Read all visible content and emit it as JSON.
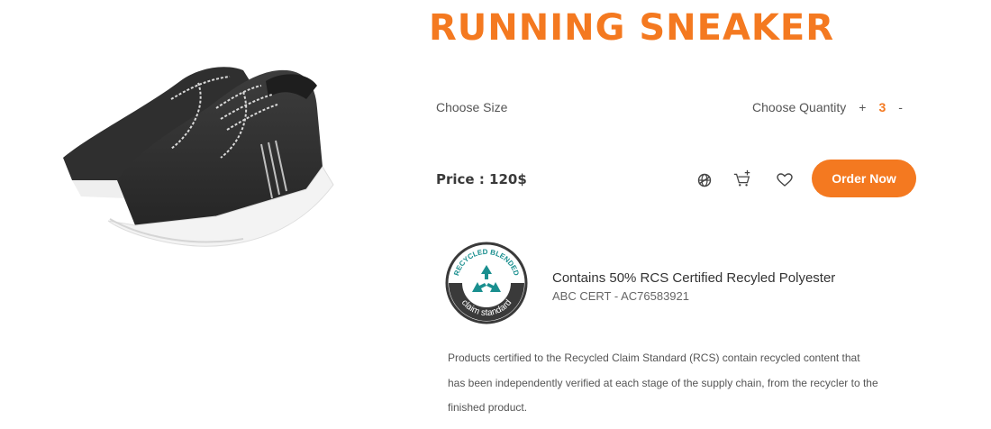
{
  "product": {
    "title": "RUNNING SNEAKER",
    "image_alt_icon": "sneaker-photo"
  },
  "options": {
    "size_label": "Choose Size",
    "quantity_label": "Choose Quantity",
    "increment_label": "+",
    "decrement_label": "-",
    "quantity_value": "3"
  },
  "pricing": {
    "price_text": "Price : 120$"
  },
  "actions": {
    "compare_icon": "compare-globe-icon",
    "cart_icon": "add-to-cart-icon",
    "wishlist_icon": "heart-icon",
    "order_label": "Order Now"
  },
  "certification": {
    "badge_top_text": "RECYCLED BLENDED",
    "badge_bottom_text": "claim standard",
    "title": "Contains 50% RCS Certified Recyled Polyester",
    "code": "ABC CERT - AC76583921",
    "description": "Products certified to the Recycled Claim Standard (RCS) contain recycled content that has been independently verified at each stage of the supply chain, from the recycler to the finished product."
  },
  "colors": {
    "accent": "#f47920",
    "badge_teal": "#1a8f8f",
    "text": "#3a3a3a"
  }
}
